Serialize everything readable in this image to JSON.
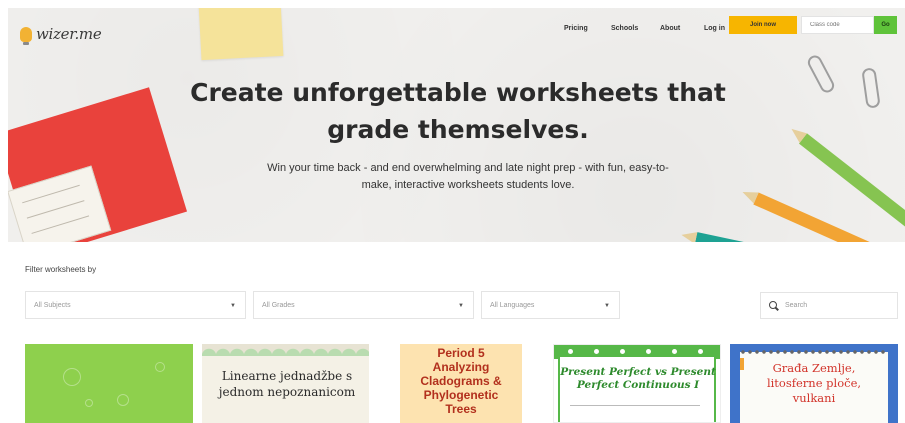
{
  "brand": {
    "name": "wizer.me"
  },
  "nav": {
    "pricing": "Pricing",
    "schools": "Schools",
    "about": "About",
    "login": "Log in",
    "join": "Join now",
    "class_code_placeholder": "Class code",
    "go": "Go"
  },
  "hero": {
    "headline_line1": "Create unforgettable worksheets that",
    "headline_line2": "grade themselves.",
    "sub_line1": "Win your time back - and end overwhelming and late night prep - with fun, easy-to-",
    "sub_line2": "make, interactive worksheets students love."
  },
  "filters": {
    "label": "Filter worksheets by",
    "subjects": "All Subjects",
    "grades": "All Grades",
    "languages": "All Languages",
    "search_placeholder": "Search"
  },
  "cards": [
    {
      "title": ""
    },
    {
      "title_line1": "Linearne jednadžbe s",
      "title_line2": "jednom nepoznanicom"
    },
    {
      "title_line1": "Period 5",
      "title_line2": "Analyzing",
      "title_line3": "Cladograms &",
      "title_line4": "Phylogenetic",
      "title_line5": "Trees"
    },
    {
      "title_line1": "Present Perfect vs Present",
      "title_line2": "Perfect Continuous I"
    },
    {
      "title_line1": "Građa Zemlje,",
      "title_line2": "litosferne ploče,",
      "title_line3": "vulkani"
    }
  ],
  "colors": {
    "accent_yellow": "#f7b500",
    "go_green": "#5fc33a",
    "headline": "#2b2b2b"
  },
  "icons": {
    "search": "search-icon",
    "logo": "lightbulb-icon",
    "caret": "chevron-down-icon"
  }
}
